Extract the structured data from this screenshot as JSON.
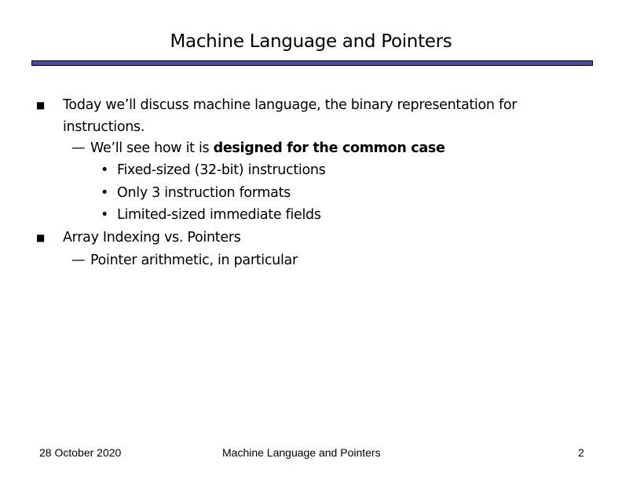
{
  "slide": {
    "title": "Machine Language and Pointers",
    "accent_color": "#4a4a9e",
    "bullets": [
      {
        "marker": "square-bullet",
        "text_line1": "Today we’ll discuss machine language, the binary representation for",
        "text_line2": "instructions.",
        "sub": {
          "marker": "—",
          "text_plain": "We’ll see how it is ",
          "text_bold": "designed for the common case",
          "items": [
            "Fixed-sized (32-bit) instructions",
            "Only 3 instruction formats",
            "Limited-sized immediate fields"
          ]
        }
      },
      {
        "marker": "square-bullet",
        "text": "Array Indexing vs. Pointers",
        "sub": {
          "marker": "—",
          "text": "Pointer arithmetic, in particular"
        }
      }
    ]
  },
  "footer": {
    "date": "28 October 2020",
    "title": "Machine Language and Pointers",
    "page_number": "2"
  }
}
